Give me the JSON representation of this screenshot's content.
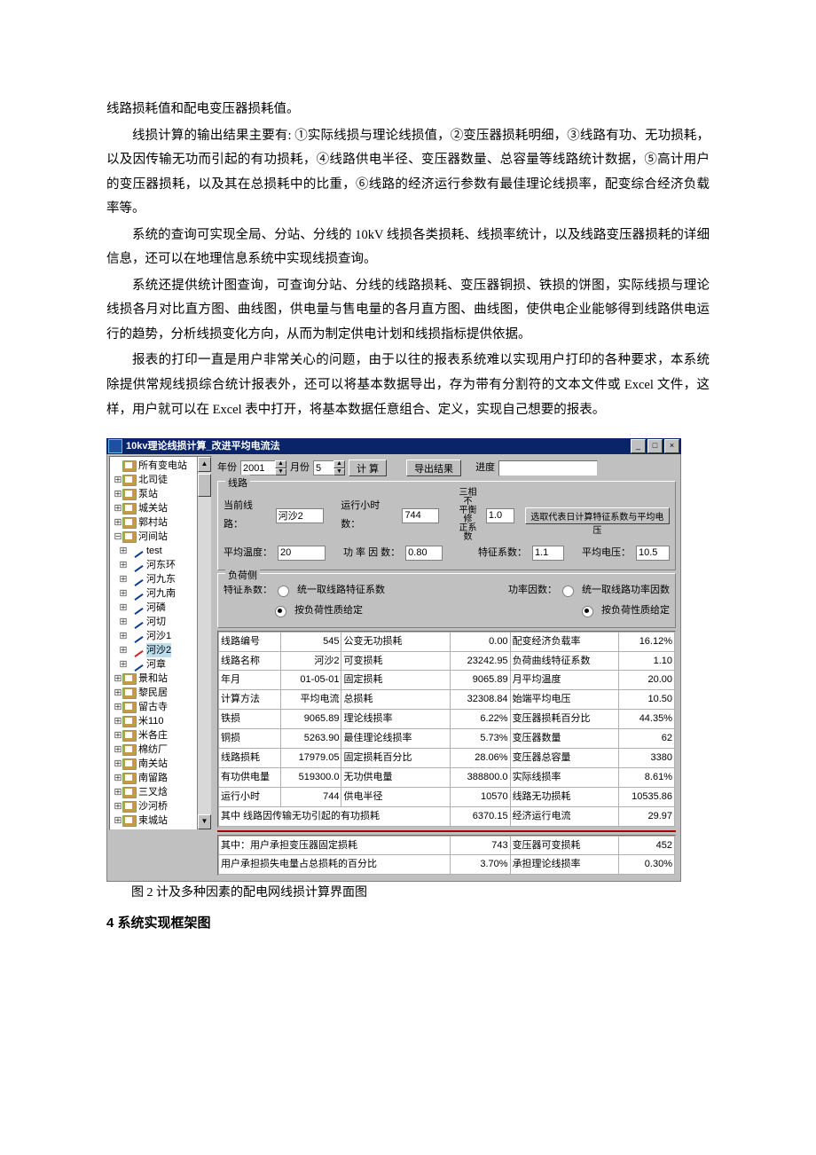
{
  "document": {
    "p1": "线路损耗值和配电变压器损耗值。",
    "p2": "线损计算的输出结果主要有: ①实际线损与理论线损值，②变压器损耗明细，③线路有功、无功损耗，以及因传输无功而引起的有功损耗，④线路供电半径、变压器数量、总容量等线路统计数据，⑤高计用户的变压器损耗，以及其在总损耗中的比重，⑥线路的经济运行参数有最佳理论线损率，配变综合经济负载率等。",
    "p3": "系统的查询可实现全局、分站、分线的 10kV 线损各类损耗、线损率统计，以及线路变压器损耗的详细信息，还可以在地理信息系统中实现线损查询。",
    "p4": "系统还提供统计图查询，可查询分站、分线的线路损耗、变压器铜损、铁损的饼图，实际线损与理论线损各月对比直方图、曲线图，供电量与售电量的各月直方图、曲线图，使供电企业能够得到线路供电运行的趋势，分析线损变化方向，从而为制定供电计划和线损指标提供依据。",
    "p5": "报表的打印一直是用户非常关心的问题，由于以往的报表系统难以实现用户打印的各种要求，本系统除提供常规线损综合统计报表外，还可以将基本数据导出，存为带有分割符的文本文件或 Excel 文件，这样，用户就可以在 Excel 表中打开，将基本数据任意组合、定义，实现自己想要的报表。",
    "caption": "图 2 计及多种因素的配电网线损计算界面图",
    "h2": "4 系统实现框架图"
  },
  "titlebar": {
    "text": "10kv理论线损计算_改进平均电流法"
  },
  "tree": {
    "root": "所有变电站",
    "stations_top": [
      "北司徒",
      "泵站",
      "城关站",
      "郭村站"
    ],
    "current_station": "河间站",
    "lines": [
      "test",
      "河东环",
      "河九东",
      "河九南",
      "河磷",
      "河切",
      "河沙1"
    ],
    "selected_line": "河沙2",
    "line_after": "河章",
    "stations_bottom": [
      "景和站",
      "黎民居",
      "留古寺",
      "米110",
      "米各庄",
      "棉纺厂",
      "南关站",
      "南留路",
      "三叉焓",
      "沙河桥",
      "束城站"
    ]
  },
  "toolbar": {
    "year_label": "年份",
    "year_value": "2001",
    "month_label": "月份",
    "month_value": "5",
    "calc_label": "计 算",
    "export_label": "导出结果",
    "progress_label": "进度"
  },
  "line_group": {
    "legend": "线路",
    "curline_label": "当前线路：",
    "curline_value": "河沙2",
    "hours_label": "运行小时数：",
    "hours_value": "744",
    "unbal_top": "三相不",
    "unbal_mid": "平衡修",
    "unbal_bot": "正系数",
    "unbal_value": "1.0",
    "pick_button": "选取代表日计算特征系数与平均电压",
    "temp_label": "平均温度：",
    "temp_value": "20",
    "pf_label": "功 率 因 数：",
    "pf_value": "0.80",
    "kchar_label": "特征系数：",
    "kchar_value": "1.1",
    "avgv_label": "平均电压：",
    "avgv_value": "10.5"
  },
  "load_group": {
    "legend": "负荷侧",
    "k_label": "特征系数：",
    "k_opt1": "统一取线路特征系数",
    "k_opt2": "按负荷性质给定",
    "pf_label": "功率因数：",
    "pf_opt1": "统一取线路功率因数",
    "pf_opt2": "按负荷性质给定"
  },
  "grid1": [
    [
      "线路编号",
      "545",
      "公变无功损耗",
      "0.00",
      "配变经济负载率",
      "16.12%"
    ],
    [
      "线路名称",
      "河沙2",
      "可变损耗",
      "23242.95",
      "负荷曲线特征系数",
      "1.10"
    ],
    [
      "年月",
      "01-05-01",
      "固定损耗",
      "9065.89",
      "月平均温度",
      "20.00"
    ],
    [
      "计算方法",
      "平均电流",
      "总损耗",
      "32308.84",
      "始端平均电压",
      "10.50"
    ],
    [
      "铁损",
      "9065.89",
      "理论线损率",
      "6.22%",
      "变压器损耗百分比",
      "44.35%"
    ],
    [
      "铜损",
      "5263.90",
      "最佳理论线损率",
      "5.73%",
      "变压器数量",
      "62"
    ],
    [
      "线路损耗",
      "17979.05",
      "固定损耗百分比",
      "28.06%",
      "变压器总容量",
      "3380"
    ],
    [
      "有功供电量",
      "519300.0",
      "无功供电量",
      "388800.0",
      "实际线损率",
      "8.61%"
    ],
    [
      "运行小时",
      "744",
      "供电半径",
      "10570",
      "线路无功损耗",
      "10535.86"
    ],
    [
      "其中 线路因传输无功引起的有功损耗",
      "",
      "",
      "6370.15",
      "经济运行电流",
      "29.97"
    ]
  ],
  "grid2": [
    [
      "其中：用户承担变压器固定损耗",
      "",
      "",
      "743",
      "变压器可变损耗",
      "452"
    ],
    [
      "用户承担损失电量占总损耗的百分比",
      "",
      "",
      "3.70%",
      "承担理论线损率",
      "0.30%"
    ]
  ]
}
